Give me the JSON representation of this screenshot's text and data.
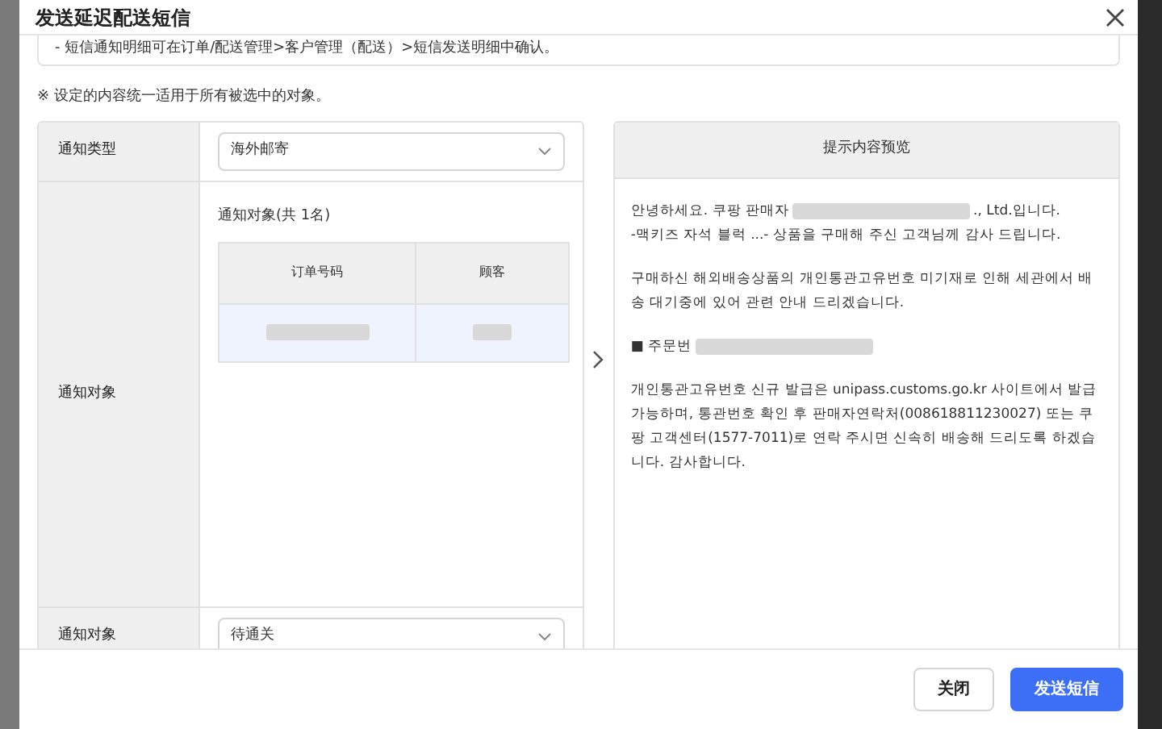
{
  "dialog": {
    "title": "发送延迟配送短信"
  },
  "notice": "- 短信通知明细可在订单/配送管理>客户管理（配送）>短信发送明细中确认。",
  "note": "※ 设定的内容统一适用于所有被选中的对象。",
  "form": {
    "rows": [
      {
        "kind": "select",
        "label": "通知类型",
        "value": "海外邮寄"
      },
      {
        "kind": "targets",
        "label": "通知对象",
        "caption": "通知对象(共 1名)",
        "columns": [
          "订单号码",
          "顾客"
        ],
        "rows": [
          {
            "cells": [
              {
                "redacted": true
              },
              {
                "redacted": true
              }
            ],
            "selected": true
          }
        ]
      },
      {
        "kind": "select",
        "label": "通知对象",
        "value": "待通关"
      }
    ]
  },
  "preview": {
    "title": "提示内容预览",
    "paragraphs": [
      {
        "lines": [
          {
            "before": "안녕하세요. 쿠팡 판매자",
            "redacted": true,
            "after": "., Ltd.입니다."
          },
          {
            "before": "-맥키즈 자석 블럭 ...- 상품을 구매해 주신 고객님께 감사 드립니다."
          }
        ]
      },
      {
        "lines": [
          {
            "before": "구매하신 해외배송상품의 개인통관고유번호 미기재로 인해 세관에서 배송 대기중에 있어 관련 안내 드리겠습니다."
          }
        ]
      },
      {
        "lines": [
          {
            "before": "■ 주문번",
            "redacted": true
          }
        ]
      },
      {
        "lines": [
          {
            "before": "개인통관고유번호 신규 발급은 unipass.customs.go.kr 사이트에서 발급 가능하며, 통관번호 확인 후 판매자연락처(008618811230027) 또는 쿠팡 고객센터(1577-7011)로 연락 주시면 신속히 배송해 드리도록 하겠습니다. 감사합니다."
          }
        ]
      }
    ]
  },
  "buttons": [
    {
      "kind": "secondary",
      "label": "关闭"
    },
    {
      "kind": "primary",
      "label": "发送短信"
    }
  ]
}
